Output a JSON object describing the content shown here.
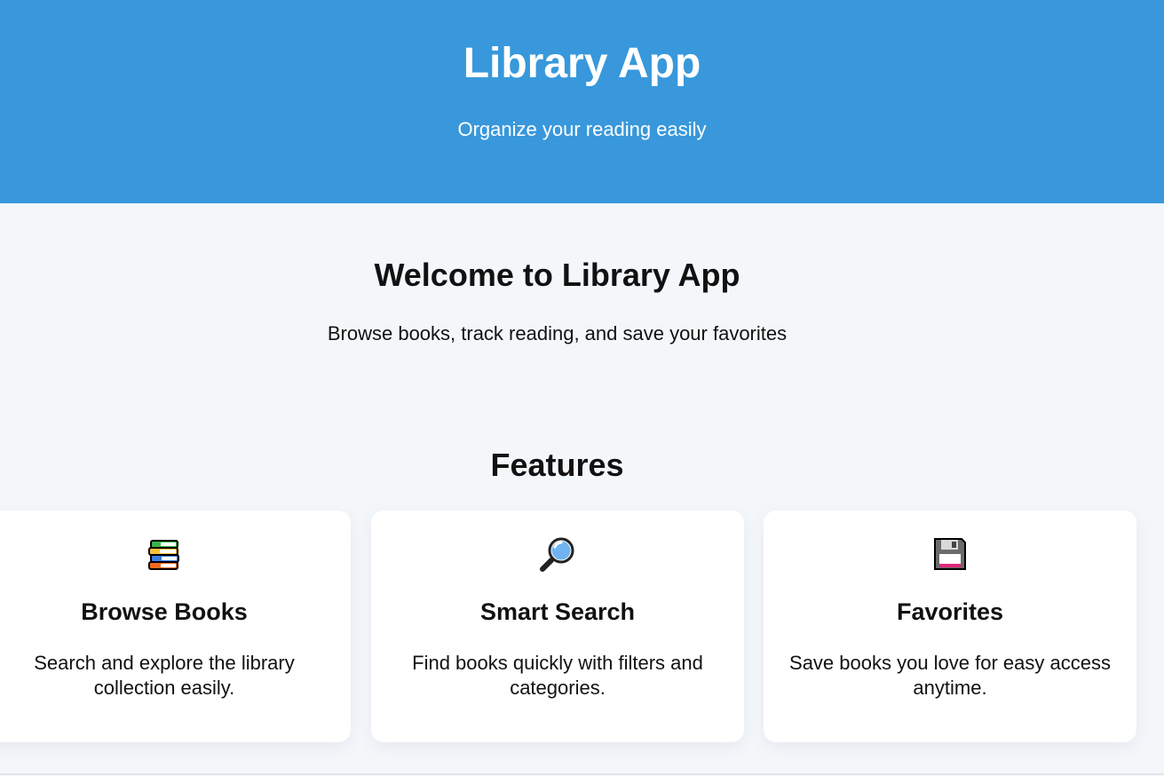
{
  "header": {
    "title": "Library App",
    "subtitle": "Organize your reading easily",
    "background_color": "#3898db"
  },
  "welcome": {
    "title": "Welcome to Library App",
    "subtitle": "Browse books, track reading, and save your favorites"
  },
  "features": {
    "title": "Features",
    "cards": [
      {
        "icon": "books-icon",
        "title": "Browse Books",
        "description": "Search and explore the library collection easily."
      },
      {
        "icon": "magnifying-glass-icon",
        "title": "Smart Search",
        "description": "Find books quickly with filters and categories."
      },
      {
        "icon": "floppy-disk-icon",
        "title": "Favorites",
        "description": "Save books you love for easy access anytime."
      }
    ]
  }
}
